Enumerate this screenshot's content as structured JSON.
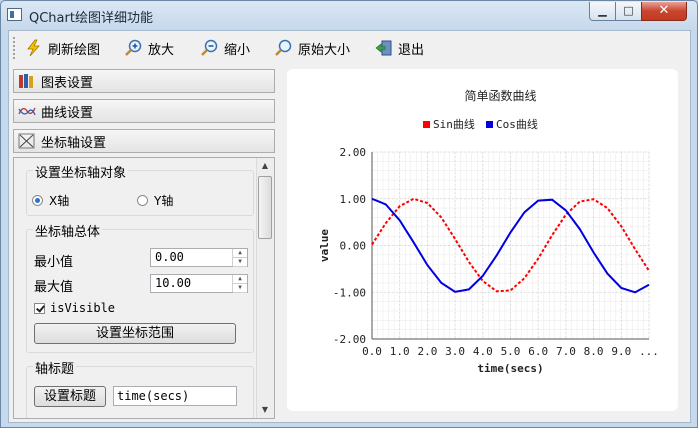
{
  "window": {
    "title": "QChart绘图详细功能"
  },
  "toolbar": {
    "refresh": "刷新绘图",
    "zoom_in": "放大",
    "zoom_out": "缩小",
    "original_size": "原始大小",
    "exit": "退出"
  },
  "sections": {
    "chart_settings": "图表设置",
    "series_settings": "曲线设置",
    "axis_settings": "坐标轴设置"
  },
  "axis_object": {
    "title": "设置坐标轴对象",
    "x_label": "X轴",
    "y_label": "Y轴",
    "selected": "X轴"
  },
  "axis_overall": {
    "title": "坐标轴总体",
    "min_label": "最小值",
    "min_value": "0.00",
    "max_label": "最大值",
    "max_value": "10.00",
    "visible_label": "isVisible",
    "visible_checked": true,
    "set_range_button": "设置坐标范围"
  },
  "axis_title": {
    "title": "轴标题",
    "set_title_button": "设置标题",
    "title_value": "time(secs)"
  },
  "colors": {
    "sin": "#ff0000",
    "cos": "#0000e0",
    "accent": "#2b74c9"
  },
  "chart_data": {
    "type": "line",
    "title": "简单函数曲线",
    "xlabel": "time(secs)",
    "ylabel": "value",
    "xlim": [
      0,
      10
    ],
    "ylim": [
      -2,
      2
    ],
    "x_ticks": [
      "0.0",
      "1.0",
      "2.0",
      "3.0",
      "4.0",
      "5.0",
      "6.0",
      "7.0",
      "8.0",
      "9.0",
      "..."
    ],
    "y_ticks": [
      "2.00",
      "1.00",
      "0.00",
      "-1.00",
      "-2.00"
    ],
    "legend_position": "top",
    "grid": true,
    "series": [
      {
        "name": "Sin曲线",
        "color": "#ff0000",
        "style": "dashed",
        "x": [
          0,
          0.5,
          1,
          1.5,
          2,
          2.5,
          3,
          3.5,
          4,
          4.5,
          5,
          5.5,
          6,
          6.5,
          7,
          7.5,
          8,
          8.5,
          9,
          9.5,
          10
        ],
        "values": [
          0.02,
          0.48,
          0.84,
          1.0,
          0.91,
          0.6,
          0.14,
          -0.35,
          -0.76,
          -0.98,
          -0.96,
          -0.7,
          -0.28,
          0.22,
          0.66,
          0.94,
          0.99,
          0.8,
          0.41,
          -0.08,
          -0.54
        ]
      },
      {
        "name": "Cos曲线",
        "color": "#0000e0",
        "style": "solid",
        "x": [
          0,
          0.5,
          1,
          1.5,
          2,
          2.5,
          3,
          3.5,
          4,
          4.5,
          5,
          5.5,
          6,
          6.5,
          7,
          7.5,
          8,
          8.5,
          9,
          9.5,
          10
        ],
        "values": [
          1.0,
          0.88,
          0.54,
          0.07,
          -0.42,
          -0.8,
          -0.99,
          -0.94,
          -0.65,
          -0.21,
          0.28,
          0.71,
          0.96,
          0.98,
          0.75,
          0.35,
          -0.15,
          -0.6,
          -0.91,
          -1.0,
          -0.84
        ]
      }
    ]
  }
}
